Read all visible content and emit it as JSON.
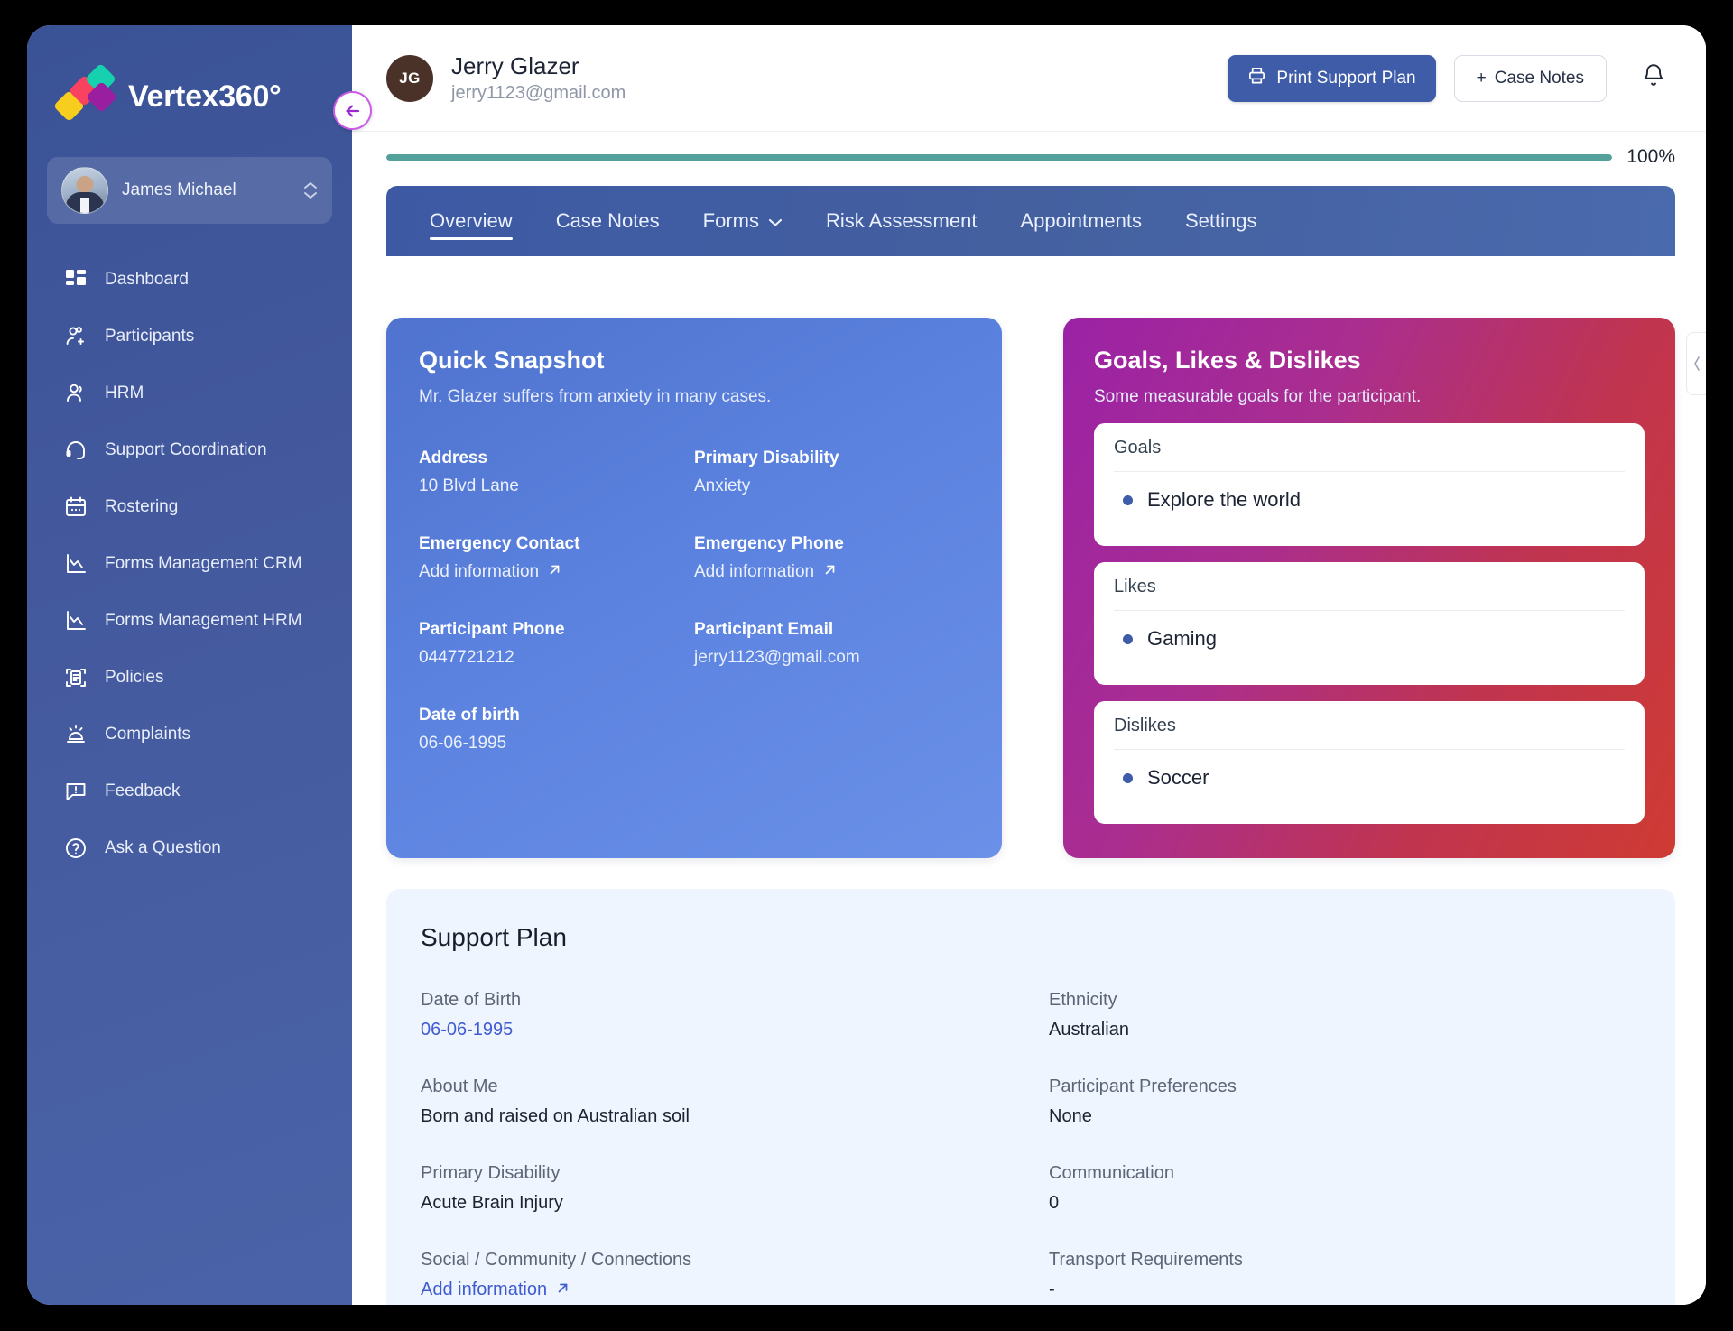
{
  "brand": {
    "name": "Vertex360°"
  },
  "user": {
    "name": "James Michael"
  },
  "sidebar": {
    "items": [
      {
        "label": "Dashboard",
        "icon": "dashboard-icon"
      },
      {
        "label": "Participants",
        "icon": "participants-icon"
      },
      {
        "label": "HRM",
        "icon": "hrm-icon"
      },
      {
        "label": "Support Coordination",
        "icon": "headset-icon"
      },
      {
        "label": "Rostering",
        "icon": "calendar-icon"
      },
      {
        "label": "Forms Management CRM",
        "icon": "chart-icon"
      },
      {
        "label": "Forms Management HRM",
        "icon": "chart-icon"
      },
      {
        "label": "Policies",
        "icon": "document-scan-icon"
      },
      {
        "label": "Complaints",
        "icon": "siren-icon"
      },
      {
        "label": "Feedback",
        "icon": "comment-alert-icon"
      },
      {
        "label": "Ask a Question",
        "icon": "question-circle-icon"
      }
    ]
  },
  "header": {
    "avatar_initials": "JG",
    "participant_name": "Jerry Glazer",
    "participant_email": "jerry1123@gmail.com",
    "print_button": "Print Support Plan",
    "case_notes_button": "Case Notes",
    "case_notes_plus": "+",
    "notifications_icon": "bell-icon"
  },
  "progress": {
    "percent_label": "100%",
    "value": 100
  },
  "tabs": [
    {
      "label": "Overview",
      "active": true
    },
    {
      "label": "Case Notes",
      "active": false
    },
    {
      "label": "Forms",
      "active": false,
      "caret": true
    },
    {
      "label": "Risk Assessment",
      "active": false
    },
    {
      "label": "Appointments",
      "active": false
    },
    {
      "label": "Settings",
      "active": false
    }
  ],
  "quick_snapshot": {
    "title": "Quick Snapshot",
    "subtitle": "Mr. Glazer suffers from anxiety in many cases.",
    "fields": [
      {
        "label": "Address",
        "value": "10 Blvd Lane",
        "link": false
      },
      {
        "label": "Primary Disability",
        "value": "Anxiety",
        "link": false
      },
      {
        "label": "Emergency Contact",
        "value": "Add information",
        "link": true
      },
      {
        "label": "Emergency Phone",
        "value": "Add information",
        "link": true
      },
      {
        "label": "Participant Phone",
        "value": "0447721212",
        "link": false
      },
      {
        "label": "Participant Email",
        "value": "jerry1123@gmail.com",
        "link": false
      },
      {
        "label": "Date of birth",
        "value": "06-06-1995",
        "link": false
      }
    ]
  },
  "goals_card": {
    "title": "Goals, Likes & Dislikes",
    "subtitle": "Some measurable goals for the participant.",
    "sections": [
      {
        "title": "Goals",
        "items": [
          "Explore the world"
        ]
      },
      {
        "title": "Likes",
        "items": [
          "Gaming"
        ]
      },
      {
        "title": "Dislikes",
        "items": [
          "Soccer"
        ]
      }
    ]
  },
  "support_plan": {
    "title": "Support Plan",
    "fields": [
      {
        "label": "Date of Birth",
        "value": "06-06-1995",
        "style": "link"
      },
      {
        "label": "Ethnicity",
        "value": "Australian",
        "style": "plain"
      },
      {
        "label": "About Me",
        "value": "Born and raised on Australian soil",
        "style": "plain"
      },
      {
        "label": "Participant Preferences",
        "value": "None",
        "style": "plain"
      },
      {
        "label": "Primary Disability",
        "value": "Acute Brain Injury",
        "style": "plain"
      },
      {
        "label": "Communication",
        "value": "0",
        "style": "plain"
      },
      {
        "label": "Social / Community / Connections",
        "value": "Add information",
        "style": "addinfo"
      },
      {
        "label": "Transport Requirements",
        "value": "-",
        "style": "plain"
      }
    ]
  },
  "colors": {
    "sidebar": "#44599d",
    "primary_button": "#3F5CA8",
    "progress": "#54A19B",
    "snapshot_card": "#5B82DF",
    "goals_gradient_start": "#9B22A6",
    "goals_gradient_end": "#CF3B33",
    "support_plan_bg": "#EFF5FE",
    "collapse_ring": "#C95BE8"
  }
}
